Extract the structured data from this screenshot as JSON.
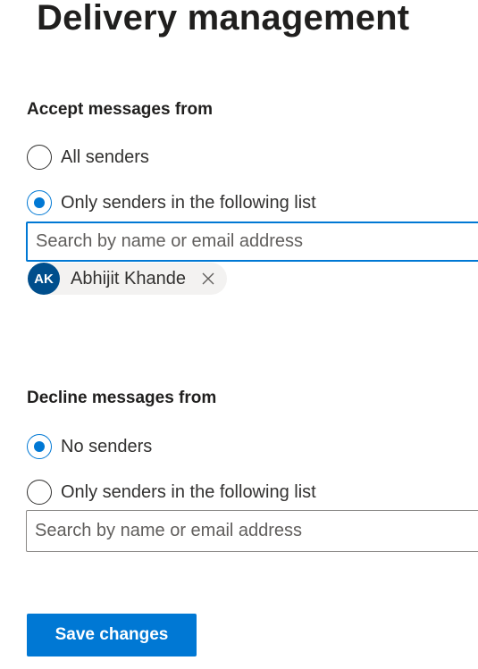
{
  "page": {
    "title": "Delivery management"
  },
  "accept": {
    "heading": "Accept messages from",
    "options": [
      {
        "label": "All senders",
        "selected": false
      },
      {
        "label": "Only senders in the following list",
        "selected": true
      }
    ],
    "search": {
      "placeholder": "Search by name or email address",
      "value": ""
    },
    "senders": [
      {
        "initials": "AK",
        "name": "Abhijit Khande",
        "avatar_color": "#004e8c"
      }
    ]
  },
  "decline": {
    "heading": "Decline messages from",
    "options": [
      {
        "label": "No senders",
        "selected": true
      },
      {
        "label": "Only senders in the following list",
        "selected": false
      }
    ],
    "search": {
      "placeholder": "Search by name or email address",
      "value": ""
    }
  },
  "actions": {
    "save_label": "Save changes"
  },
  "colors": {
    "accent": "#0078d4",
    "avatar": "#004e8c",
    "text": "#323130",
    "chip_background": "#f3f2f1"
  },
  "icons": {
    "remove_sender": "close-icon"
  }
}
